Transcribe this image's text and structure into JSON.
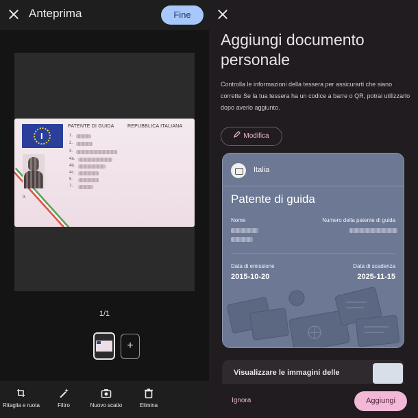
{
  "left": {
    "title": "Anteprima",
    "done_label": "Fine",
    "licence": {
      "header_left": "PATENTE DI GUIDA",
      "header_right": "REPUBBLICA ITALIANA",
      "flag_letter": "I",
      "field_numbers": [
        "1.",
        "2.",
        "3.",
        "4a.",
        "4b.",
        "4c.",
        "5.",
        "7.",
        "9."
      ]
    },
    "pager": "1/1",
    "add_page": "+",
    "tools": [
      {
        "label": "Ritaglia e ruota",
        "icon": "crop-rotate-icon"
      },
      {
        "label": "Filtro",
        "icon": "magic-wand-icon"
      },
      {
        "label": "Nuovo scatto",
        "icon": "camera-icon"
      },
      {
        "label": "Elimina",
        "icon": "trash-icon"
      }
    ]
  },
  "right": {
    "heading": "Aggiungi documento personale",
    "description": "Controlla le informazioni della tessera per assicurarti che siano corrette Se la tua tessera ha un codice a barre o QR, potrai utilizzarlo dopo averlo aggiunto.",
    "edit_label": "Modifica",
    "card": {
      "country": "Italia",
      "doc_type": "Patente di guida",
      "name_label": "Nome",
      "number_label": "Numero della patente di guida",
      "issue_label": "Data di emissione",
      "issue_value": "2015-10-20",
      "expiry_label": "Data di scadenza",
      "expiry_value": "2025-11-15",
      "color": "#6d7894"
    },
    "images_label": "Visualizzare le immagini delle",
    "ignore_label": "Ignora",
    "add_label": "Aggiungi",
    "accent": "#f2b8d6"
  }
}
